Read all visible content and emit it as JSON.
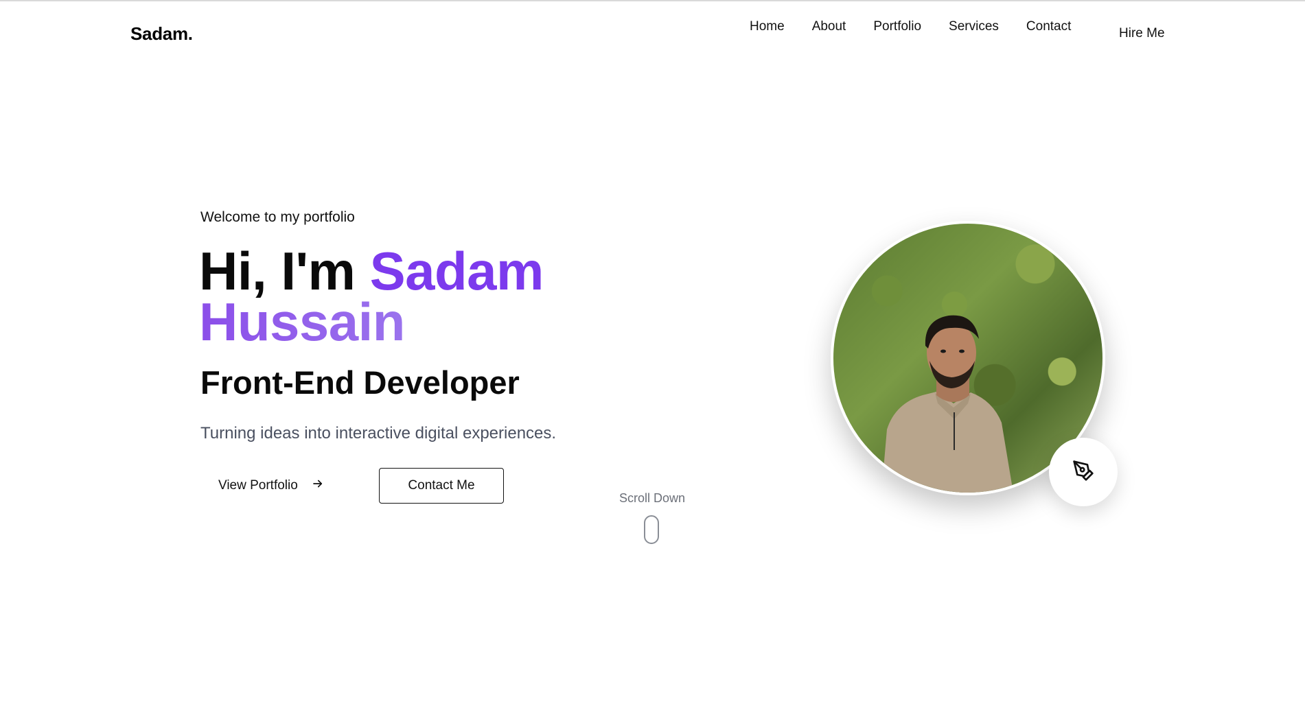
{
  "header": {
    "logo": "Sadam.",
    "nav": [
      {
        "label": "Home"
      },
      {
        "label": "About"
      },
      {
        "label": "Portfolio"
      },
      {
        "label": "Services"
      },
      {
        "label": "Contact"
      }
    ],
    "hire_me": "Hire Me"
  },
  "hero": {
    "welcome": "Welcome to my portfolio",
    "title_lead": "Hi, I'm ",
    "title_name_first": "Sadam",
    "title_name_last": "Hussain",
    "role": "Front-End Developer",
    "tagline": "Turning ideas into interactive digital experiences.",
    "buttons": {
      "portfolio": "View Portfolio",
      "contact": "Contact Me"
    },
    "scroll_label": "Scroll Down"
  },
  "colors": {
    "accent": "#7c3aed",
    "accent_light": "#a58cf0",
    "text": "#0a0a0a",
    "muted": "#4a5060"
  },
  "icons": {
    "portfolio_arrow": "arrow-right-icon",
    "badge": "pen-tool-icon",
    "scroll": "mouse-icon"
  }
}
